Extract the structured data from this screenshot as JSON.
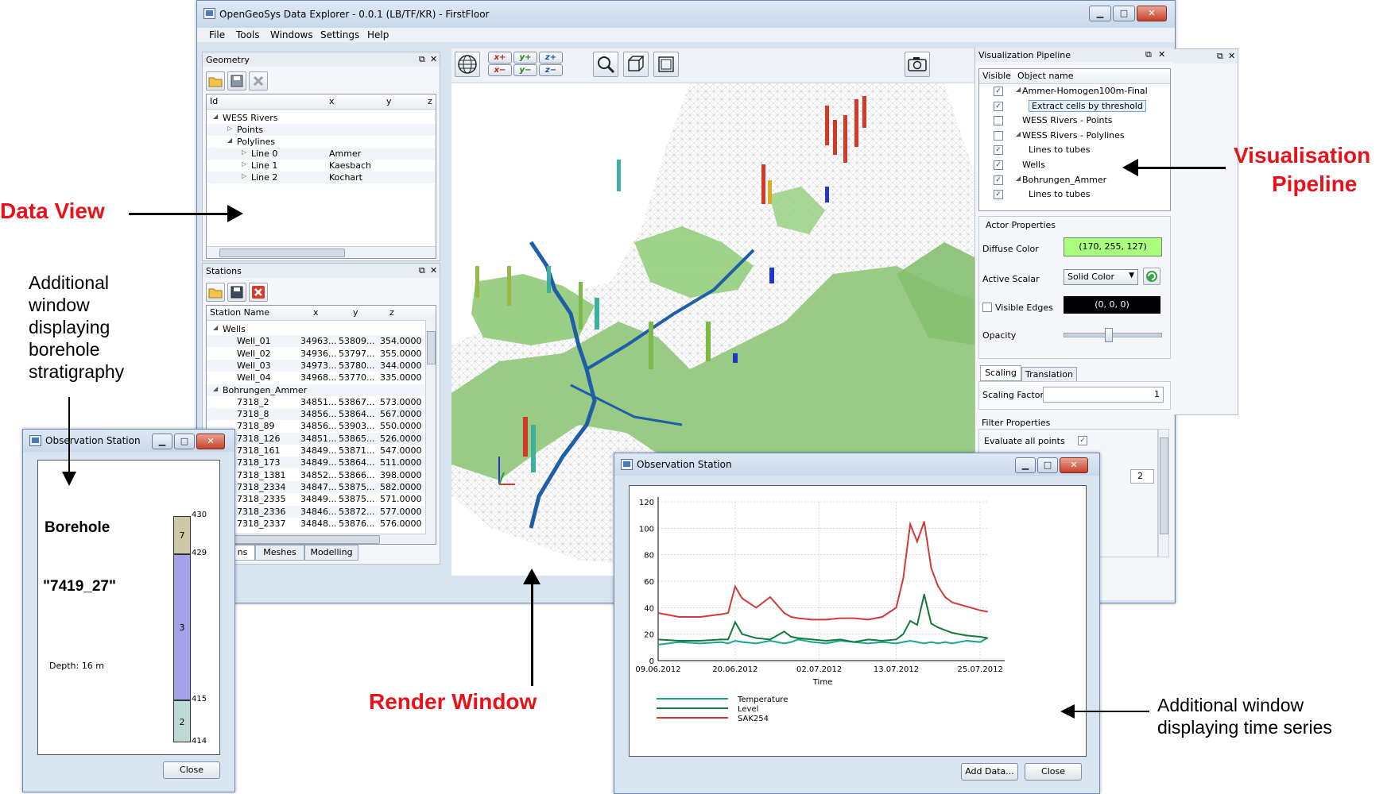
{
  "main_window": {
    "title": "OpenGeoSys Data Explorer - 0.0.1 (LB/TF/KR) - FirstFloor",
    "menu": [
      "File",
      "Tools",
      "Windows",
      "Settings",
      "Help"
    ],
    "caption_buttons": {
      "minimize": "▁",
      "maximize": "□",
      "close": "✕"
    }
  },
  "geometry_panel": {
    "title": "Geometry",
    "columns": [
      "Id",
      "x",
      "y",
      "z"
    ],
    "rows": [
      {
        "indent": 0,
        "expander": "◢",
        "id": "WESS Rivers",
        "x": ""
      },
      {
        "indent": 1,
        "expander": "▷",
        "id": "Points",
        "x": ""
      },
      {
        "indent": 1,
        "expander": "◢",
        "id": "Polylines",
        "x": ""
      },
      {
        "indent": 2,
        "expander": "▷",
        "id": "Line 0",
        "x": "Ammer"
      },
      {
        "indent": 2,
        "expander": "▷",
        "id": "Line 1",
        "x": "Kaesbach"
      },
      {
        "indent": 2,
        "expander": "▷",
        "id": "Line 2",
        "x": "Kochart"
      }
    ]
  },
  "stations_panel": {
    "title": "Stations",
    "columns": [
      "Station Name",
      "x",
      "y",
      "z"
    ],
    "rows": [
      {
        "group": true,
        "name": "Wells"
      },
      {
        "name": "Well_01",
        "x": "34963...",
        "y": "53809...",
        "z": "354.0000"
      },
      {
        "name": "Well_02",
        "x": "34936...",
        "y": "53797...",
        "z": "355.0000"
      },
      {
        "name": "Well_03",
        "x": "34973...",
        "y": "53780...",
        "z": "344.0000"
      },
      {
        "name": "Well_04",
        "x": "34968...",
        "y": "53770...",
        "z": "335.0000"
      },
      {
        "group": true,
        "name": "Bohrungen_Ammer"
      },
      {
        "name": "7318_2",
        "x": "34851...",
        "y": "53867...",
        "z": "573.0000"
      },
      {
        "name": "7318_8",
        "x": "34856...",
        "y": "53864...",
        "z": "567.0000"
      },
      {
        "name": "7318_89",
        "x": "34856...",
        "y": "53903...",
        "z": "550.0000"
      },
      {
        "name": "7318_126",
        "x": "34851...",
        "y": "53865...",
        "z": "526.0000"
      },
      {
        "name": "7318_161",
        "x": "34849...",
        "y": "53871...",
        "z": "547.0000"
      },
      {
        "name": "7318_173",
        "x": "34849...",
        "y": "53864...",
        "z": "511.0000"
      },
      {
        "name": "7318_1381",
        "x": "34852...",
        "y": "53866...",
        "z": "398.0000"
      },
      {
        "name": "7318_2334",
        "x": "34847...",
        "y": "53875...",
        "z": "582.0000"
      },
      {
        "name": "7318_2335",
        "x": "34849...",
        "y": "53875...",
        "z": "571.0000"
      },
      {
        "name": "7318_2336",
        "x": "34846...",
        "y": "53872...",
        "z": "577.0000"
      },
      {
        "name": "7318_2337",
        "x": "34848...",
        "y": "53876...",
        "z": "576.0000"
      }
    ],
    "bottom_tabs": [
      "ns",
      "Meshes",
      "Modelling"
    ]
  },
  "render_toolbar": {
    "axis_buttons": [
      "x+",
      "y+",
      "z+",
      "x−",
      "y−",
      "z−"
    ]
  },
  "pipeline_panel": {
    "title": "Visualization Pipeline",
    "columns": [
      "Visible",
      "Object name"
    ],
    "rows": [
      {
        "checked": true,
        "expander": "◢",
        "name": "Ammer-Homogen100m-Final",
        "indent": 0
      },
      {
        "checked": true,
        "expander": "",
        "name": "Extract cells by threshold",
        "indent": 1,
        "selected": true
      },
      {
        "checked": false,
        "expander": "",
        "name": "WESS Rivers - Points",
        "indent": 0
      },
      {
        "checked": false,
        "expander": "◢",
        "name": "WESS Rivers - Polylines",
        "indent": 0
      },
      {
        "checked": true,
        "expander": "",
        "name": "Lines to tubes",
        "indent": 1
      },
      {
        "checked": true,
        "expander": "",
        "name": "Wells",
        "indent": 0
      },
      {
        "checked": true,
        "expander": "◢",
        "name": "Bohrungen_Ammer",
        "indent": 0
      },
      {
        "checked": true,
        "expander": "",
        "name": "Lines to tubes",
        "indent": 1
      }
    ],
    "actor_properties": {
      "title": "Actor Properties",
      "diffuse_label": "Diffuse Color",
      "diffuse_value": "(170, 255, 127)",
      "diffuse_color": "#aaff7f",
      "active_scalar_label": "Active Scalar",
      "active_scalar_value": "Solid Color",
      "visible_edges_label": "Visible Edges",
      "edge_color_value": "(0, 0, 0)",
      "opacity_label": "Opacity",
      "opacity_level": 0.45
    },
    "tabs": [
      "Scaling",
      "Translation"
    ],
    "scaling_factor_label": "Scaling Factor",
    "scaling_factor_value": "1",
    "filter_properties": {
      "title": "Filter Properties",
      "evaluate_label": "Evaluate all points",
      "field_value": "2"
    }
  },
  "borehole_window": {
    "title": "Observation Station",
    "heading": "Borehole",
    "borehole_id": "\"7419_27\"",
    "depth_label": "Depth: 16 m",
    "layers": [
      {
        "label": "7",
        "top": 430,
        "bottom": 429,
        "color": "#cdc9a4"
      },
      {
        "label": "3",
        "top": 429,
        "bottom": 415,
        "color": "#a4a2e8"
      },
      {
        "label": "2",
        "top": 415,
        "bottom": 414,
        "color": "#bcd9d6"
      }
    ],
    "depth_ticks": [
      "430",
      "429",
      "415",
      "414"
    ],
    "close_label": "Close"
  },
  "timeseries_window": {
    "title": "Observation Station",
    "add_data_label": "Add Data...",
    "close_label": "Close"
  },
  "chart_data": {
    "type": "line",
    "xlabel": "Time",
    "ylabel": "",
    "x_ticks": [
      "09.06.2012",
      "20.06.2012",
      "02.07.2012",
      "13.07.2012",
      "25.07.2012"
    ],
    "y_ticks": [
      "0",
      "20",
      "40",
      "60",
      "80",
      "100",
      "120"
    ],
    "ylim": [
      0,
      120
    ],
    "grid": true,
    "legend_position": "bottom-left",
    "x_days": [
      0,
      3,
      6,
      9,
      10,
      11,
      12,
      14,
      16,
      18,
      19,
      20,
      22,
      24,
      26,
      28,
      30,
      32,
      34,
      35,
      36,
      37,
      38,
      39,
      40,
      41,
      42,
      44,
      46,
      47
    ],
    "series": [
      {
        "name": "Temperature",
        "color": "#1aa68c",
        "values": [
          12,
          14,
          13,
          14,
          13,
          15,
          14,
          13,
          15,
          13,
          14,
          16,
          14,
          13,
          15,
          14,
          13,
          14,
          13,
          14,
          15,
          14,
          13,
          14,
          13,
          14,
          13,
          15,
          14,
          17
        ]
      },
      {
        "name": "Level",
        "color": "#127a3a",
        "values": [
          16,
          15,
          15,
          16,
          16,
          29,
          20,
          17,
          16,
          22,
          18,
          17,
          16,
          15,
          16,
          14,
          16,
          15,
          16,
          20,
          30,
          27,
          50,
          28,
          25,
          23,
          21,
          19,
          18,
          17
        ]
      },
      {
        "name": "SAK254",
        "color": "#d03a3a",
        "values": [
          36,
          33,
          33,
          35,
          36,
          56,
          47,
          40,
          48,
          36,
          33,
          32,
          31,
          31,
          32,
          32,
          31,
          33,
          40,
          62,
          103,
          90,
          105,
          70,
          56,
          48,
          44,
          41,
          38,
          37
        ]
      }
    ]
  },
  "annotations": {
    "data_view": "Data View",
    "visualisation_pipeline_1": "Visualisation",
    "visualisation_pipeline_2": "Pipeline",
    "render_window": "Render Window",
    "borehole_note": [
      "Additional",
      "window",
      "displaying",
      "borehole",
      "stratigraphy"
    ],
    "timeseries_note": [
      "Additional window",
      "displaying time series"
    ]
  }
}
